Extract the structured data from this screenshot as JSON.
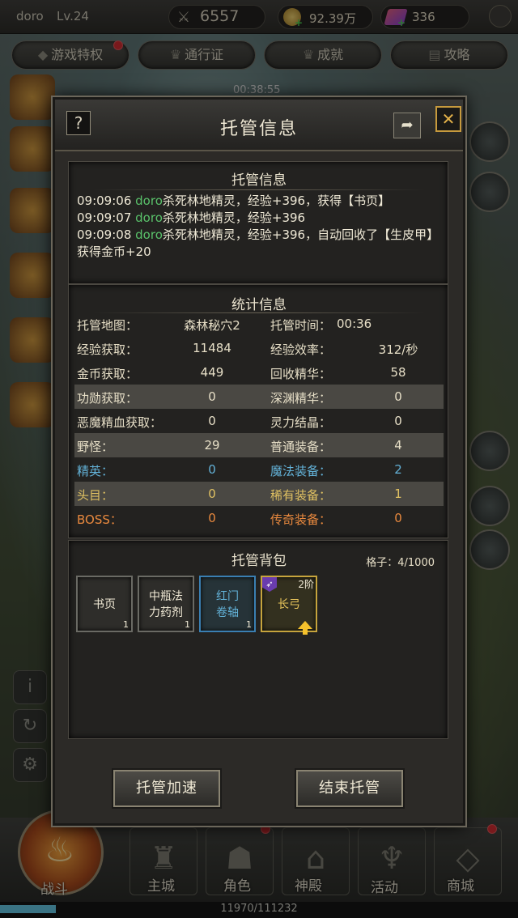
{
  "player": {
    "name": "doro",
    "level": "Lv.24"
  },
  "resources": {
    "power": "6557",
    "gold": "92.39万",
    "gems": "336"
  },
  "top_tabs": [
    {
      "label": "游戏特权"
    },
    {
      "label": "通行证"
    },
    {
      "label": "成就"
    },
    {
      "label": "攻略"
    }
  ],
  "timer": "00:38:55",
  "modal": {
    "title": "托管信息",
    "help_glyph": "?",
    "close_glyph": "✕",
    "log_section": {
      "title": "托管信息",
      "lines": [
        {
          "time": "09:09:06",
          "actor": "doro",
          "text": "杀死林地精灵，经验+396，获得【书页】"
        },
        {
          "time": "09:09:07",
          "actor": "doro",
          "text": "杀死林地精灵，经验+396"
        },
        {
          "time": "09:09:08",
          "actor": "doro",
          "text": "杀死林地精灵，经验+396，自动回收了【生皮甲】获得金币+20"
        }
      ]
    },
    "stats_section": {
      "title": "统计信息",
      "rows": [
        {
          "l1": "托管地图：",
          "v1": "森林秘穴2",
          "l2": "托管时间：",
          "v2": "00:36"
        },
        {
          "l1": "经验获取：",
          "v1": "11484",
          "l2": "经验效率：",
          "v2": "312/秒"
        },
        {
          "l1": "金币获取：",
          "v1": "449",
          "l2": "回收精华：",
          "v2": "58"
        },
        {
          "l1": "功勋获取：",
          "v1": "0",
          "l2": "深渊精华：",
          "v2": "0"
        },
        {
          "l1": "恶魔精血获取：",
          "v1": "0",
          "l2": "灵力结晶：",
          "v2": "0"
        },
        {
          "l1": "野怪：",
          "v1": "29",
          "l2": "普通装备：",
          "v2": "4"
        },
        {
          "l1": "精英：",
          "v1": "0",
          "l2": "魔法装备：",
          "v2": "2"
        },
        {
          "l1": "头目：",
          "v1": "0",
          "l2": "稀有装备：",
          "v2": "1"
        },
        {
          "l1": "BOSS：",
          "v1": "0",
          "l2": "传奇装备：",
          "v2": "0"
        }
      ]
    },
    "bag_section": {
      "title": "托管背包",
      "capacity_label": "格子：",
      "capacity": "4/1000",
      "items": [
        {
          "name": "书页",
          "count": "1",
          "rarity": "normal"
        },
        {
          "name": "中瓶法力药剂",
          "count": "1",
          "rarity": "normal"
        },
        {
          "name": "红门卷轴",
          "count": "1",
          "rarity": "magic"
        },
        {
          "name": "长弓",
          "tier": "2阶",
          "rarity": "rare",
          "upgrade": true
        }
      ]
    },
    "buttons": {
      "speed": "托管加速",
      "stop": "结束托管"
    }
  },
  "bottom_nav": [
    {
      "label": "战斗"
    },
    {
      "label": "主城"
    },
    {
      "label": "角色"
    },
    {
      "label": "神殿"
    },
    {
      "label": "活动"
    },
    {
      "label": "商城"
    }
  ],
  "exp": {
    "text": "11970/111232",
    "fraction": 0.108
  },
  "colors": {
    "kill_actor": "#59c16a",
    "elite": "#63b2d8",
    "boss_rare": "#e0c162",
    "legendary": "#e9893e",
    "close_accent": "#e4b24a"
  }
}
